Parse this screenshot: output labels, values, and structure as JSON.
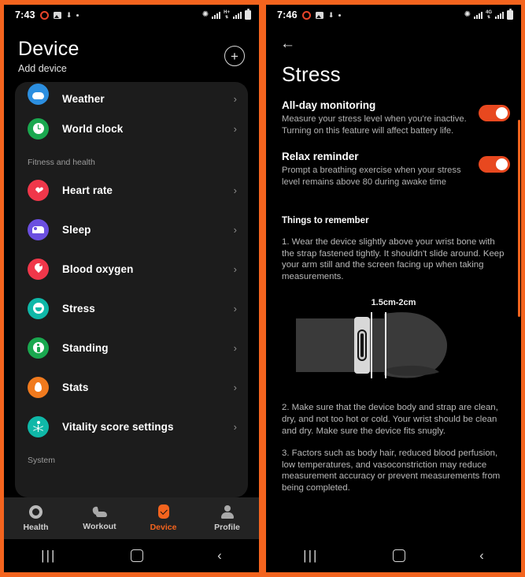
{
  "theme": {
    "accent": "#f4641e",
    "toggle_on": "#e8481f",
    "card_bg": "#1c1c1c",
    "page_bg": "#000000"
  },
  "left_phone": {
    "statusbar": {
      "time": "7:43",
      "network": "H+",
      "icons": [
        "record-icon",
        "screenshot-icon",
        "download-icon",
        "dot-icon",
        "bluetooth-icon",
        "signal-icon",
        "network-icon",
        "signal-icon",
        "battery-icon"
      ]
    },
    "header": {
      "title": "Device",
      "subtitle": "Add device",
      "add_button": "+"
    },
    "list": [
      {
        "label": "Weather",
        "icon": "weather-icon",
        "color": "#2c8fe0",
        "chevron": "›",
        "clipped": true
      },
      {
        "label": "World clock",
        "icon": "clock-icon",
        "color": "#1aa84f",
        "chevron": "›"
      }
    ],
    "section_fitness": "Fitness and health",
    "fitness_list": [
      {
        "label": "Heart rate",
        "icon": "heart-icon",
        "color": "#f0374a",
        "chevron": "›"
      },
      {
        "label": "Sleep",
        "icon": "bed-icon",
        "color": "#6b4fe0",
        "chevron": "›"
      },
      {
        "label": "Blood oxygen",
        "icon": "blood-drop-icon",
        "color": "#f0374a",
        "chevron": "›"
      },
      {
        "label": "Stress",
        "icon": "face-icon",
        "color": "#0fb8a8",
        "chevron": "›"
      },
      {
        "label": "Standing",
        "icon": "standing-person-icon",
        "color": "#1aa84f",
        "chevron": "›"
      },
      {
        "label": "Stats",
        "icon": "flame-icon",
        "color": "#f07a1e",
        "chevron": "›"
      },
      {
        "label": "Vitality score settings",
        "icon": "vitality-icon",
        "color": "#0fb8a8",
        "chevron": "›"
      }
    ],
    "section_system": "System",
    "tabs": [
      {
        "label": "Health",
        "icon": "health-ring-icon",
        "active": false
      },
      {
        "label": "Workout",
        "icon": "shoe-icon",
        "active": false
      },
      {
        "label": "Device",
        "icon": "watch-check-icon",
        "active": true
      },
      {
        "label": "Profile",
        "icon": "person-icon",
        "active": false
      }
    ],
    "navbar": {
      "recent": "|||",
      "home": "home-square-icon",
      "back": "‹"
    }
  },
  "right_phone": {
    "statusbar": {
      "time": "7:46",
      "network": "4G"
    },
    "back": "←",
    "title": "Stress",
    "settings": [
      {
        "title": "All-day monitoring",
        "desc": "Measure your stress level when you're inactive. Turning on this feature will affect battery life.",
        "toggle_state": "on"
      },
      {
        "title": "Relax reminder",
        "desc": "Prompt a breathing exercise when your stress level remains above 80 during awake time",
        "toggle_state": "on"
      }
    ],
    "things_heading": "Things to remember",
    "things": [
      "1. Wear the device slightly above your wrist bone with the strap fastened tightly. It shouldn't slide around. Keep your arm still and the screen facing up when taking measurements.",
      "2. Make sure that the device body and strap are clean, dry, and not too hot or cold. Your wrist should be clean and dry. Make sure the device fits snugly.",
      "3. Factors such as body hair, reduced blood perfusion, low temperatures, and vasoconstriction may reduce measurement accuracy or prevent measurements from being completed."
    ],
    "illustration": {
      "caption": "1.5cm-2cm",
      "alt": "wrist-with-band-illustration"
    },
    "navbar": {
      "recent": "|||",
      "home": "home-square-icon",
      "back": "‹"
    }
  }
}
